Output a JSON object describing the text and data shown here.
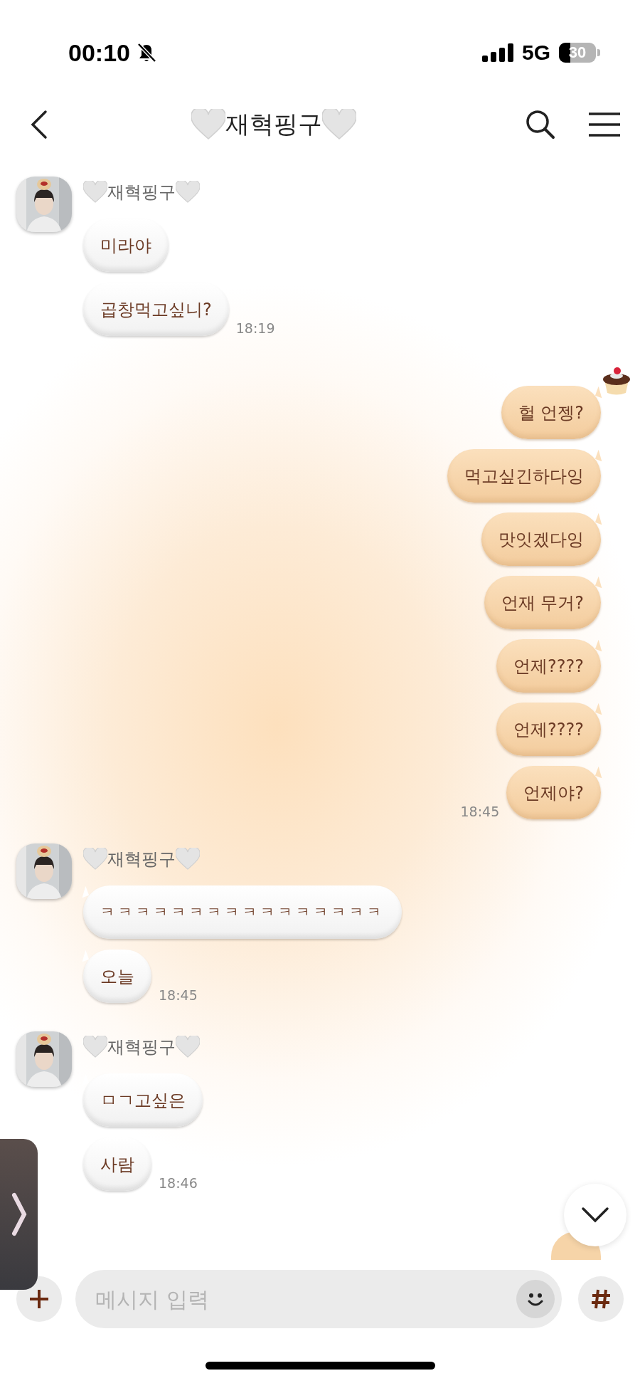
{
  "status_bar": {
    "time": "00:10",
    "network": "5G",
    "battery": "30"
  },
  "header": {
    "title": "재혁핑구"
  },
  "groups": [
    {
      "kind": "received",
      "sender": "재혁핑구",
      "time": "18:19",
      "messages": [
        "미라야",
        "곱창먹고싶니?"
      ]
    },
    {
      "kind": "sent",
      "time": "18:45",
      "messages": [
        "헐 언젱?",
        "먹고싶긴하다잉",
        "맛잇겠다잉",
        "언재 무거?",
        "언제????",
        "언제????",
        "언제야?"
      ]
    },
    {
      "kind": "received",
      "sender": "재혁핑구",
      "time": "18:45",
      "messages": [
        "ㅋㅋㅋㅋㅋㅋㅋㅋㅋㅋㅋㅋㅋㅋㅋㅋ",
        "오늘"
      ]
    },
    {
      "kind": "received",
      "sender": "재혁핑구",
      "time": "18:46",
      "messages": [
        "ㅁㄱ고싶은",
        "사람"
      ]
    }
  ],
  "input": {
    "placeholder": "메시지 입력"
  }
}
